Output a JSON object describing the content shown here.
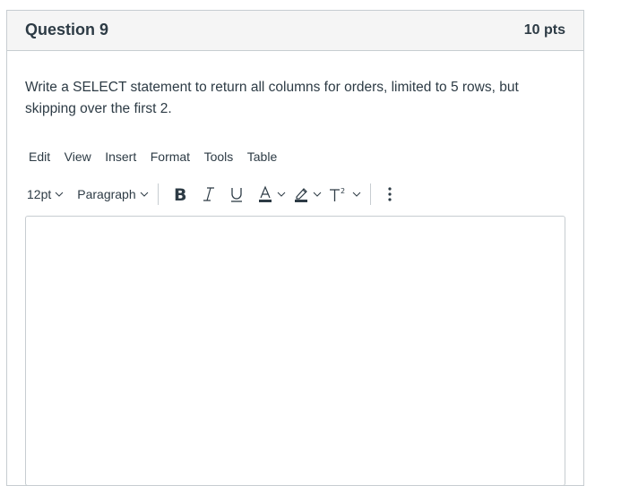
{
  "question": {
    "title": "Question 9",
    "points": "10 pts",
    "text": "Write a SELECT statement to return all columns for orders, limited to 5 rows, but skipping over the first 2."
  },
  "editor": {
    "menu": [
      "Edit",
      "View",
      "Insert",
      "Format",
      "Tools",
      "Table"
    ],
    "toolbar": {
      "font_size": "12pt",
      "block_format": "Paragraph",
      "bold_icon": "bold-icon",
      "italic_icon": "italic-icon",
      "underline_icon": "underline-icon",
      "text_color_icon": "text-color-icon",
      "highlight_icon": "highlight-color-icon",
      "superscript_icon": "superscript-icon",
      "more_icon": "more-vertical-icon"
    },
    "content": ""
  }
}
